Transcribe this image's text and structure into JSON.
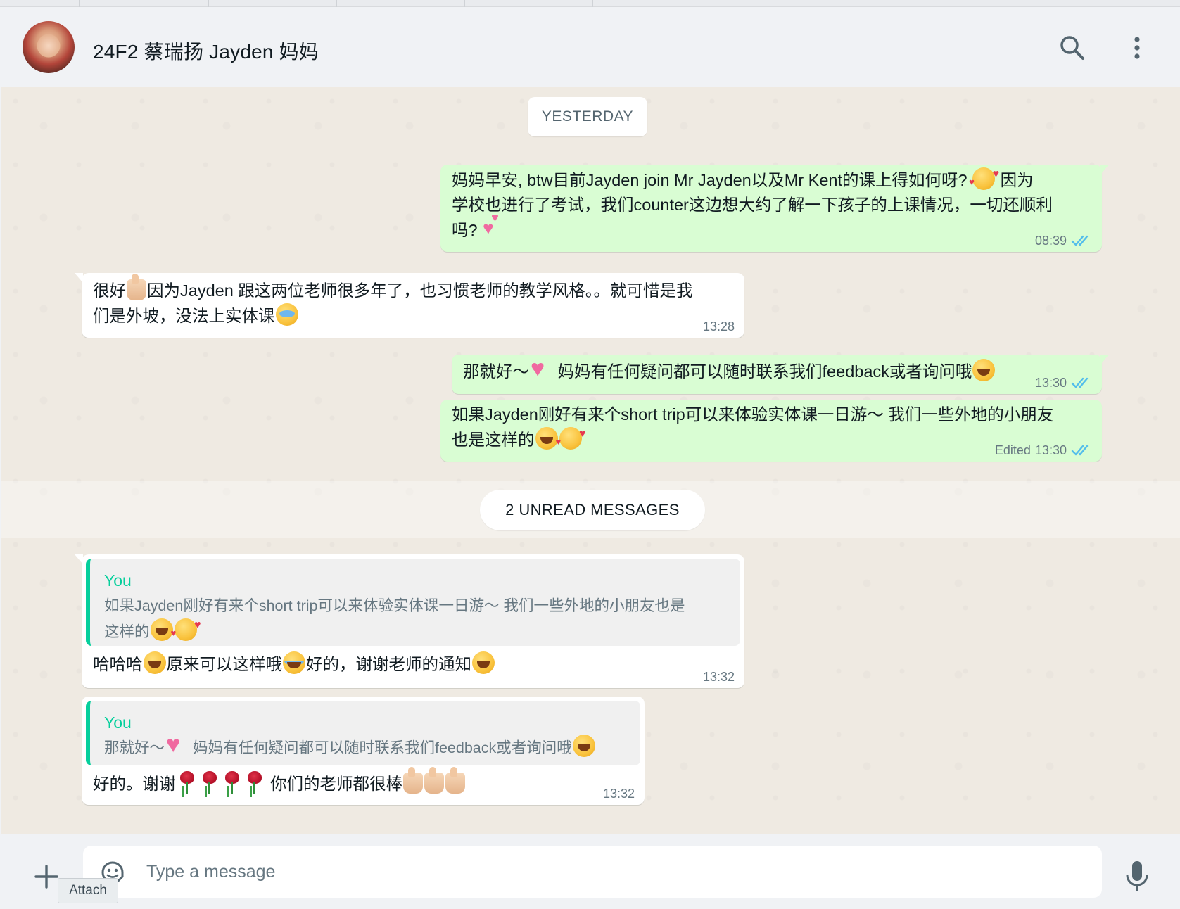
{
  "header": {
    "title": "24F2 蔡瑞扬 Jayden 妈妈"
  },
  "chat": {
    "date_divider": "YESTERDAY",
    "unread_divider": "2 UNREAD MESSAGES",
    "messages": [
      {
        "direction": "outgoing",
        "lines": [
          "妈妈早安, btw目前Jayden join Mr Jayden以及Mr Kent的课上得如何呀? ",
          " 因为",
          "学校也进行了考试，我们counter这边想大约了解一下孩子的上课情况，一切还顺利",
          "吗? "
        ],
        "time": "08:39",
        "status": "read"
      },
      {
        "direction": "incoming",
        "lines": [
          "很好",
          "因为Jayden 跟这两位老师很多年了，也习惯老师的教学风格。。就可惜是我",
          "们是外坡，没法上实体课"
        ],
        "time": "13:28"
      },
      {
        "direction": "outgoing",
        "lines": [
          "那就好～",
          " 妈妈有任何疑问都可以随时联系我们feedback或者询问哦"
        ],
        "time": "13:30",
        "status": "read"
      },
      {
        "direction": "outgoing",
        "lines": [
          "如果Jayden刚好有来个short trip可以来体验实体课一日游～ 我们一些外地的小朋友",
          "也是这样的"
        ],
        "time": "13:30",
        "edited_label": "Edited",
        "status": "read"
      },
      {
        "direction": "incoming",
        "quote": {
          "author": "You",
          "lines": [
            "如果Jayden刚好有来个short trip可以来体验实体课一日游～ 我们一些外地的小朋友也是",
            "这样的"
          ]
        },
        "lines": [
          "哈哈哈",
          "原来可以这样哦",
          "好的，谢谢老师的通知"
        ],
        "time": "13:32"
      },
      {
        "direction": "incoming",
        "quote": {
          "author": "You",
          "lines": [
            "那就好～",
            " 妈妈有任何疑问都可以随时联系我们feedback或者询问哦"
          ]
        },
        "lines": [
          "好的。谢谢",
          " 你们的老师都很棒"
        ],
        "time": "13:32"
      }
    ]
  },
  "composer": {
    "placeholder": "Type a message",
    "attach_tooltip": "Attach"
  },
  "icons": {
    "search": "search-icon",
    "menu": "kebab-menu-icon",
    "attach": "plus-icon",
    "sticker": "sticker-icon",
    "mic": "microphone-icon",
    "read_receipt": "double-check-icon"
  },
  "colors": {
    "outgoing_bubble": "#d9fdd3",
    "incoming_bubble": "#ffffff",
    "chat_background": "#efeae2",
    "read_tick": "#53bdeb",
    "quote_accent": "#06cf9c"
  }
}
